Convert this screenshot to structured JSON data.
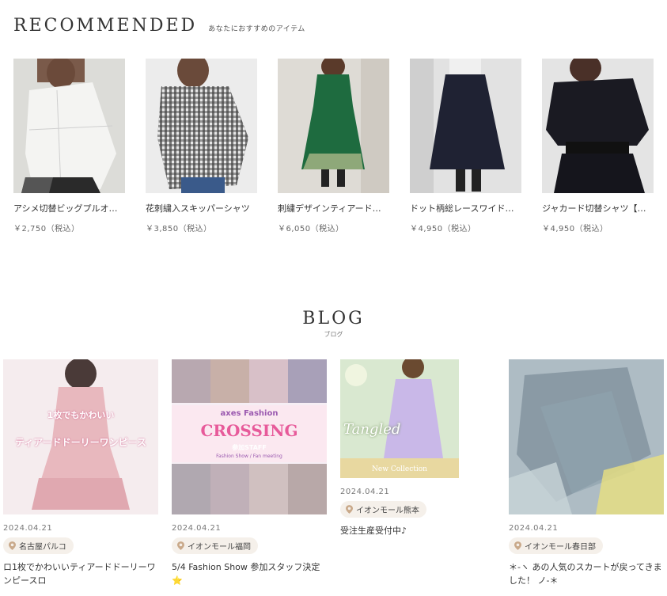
{
  "recommended": {
    "title": "RECOMMENDED",
    "subtitle": "あなたにおすすめのアイテム",
    "products": [
      {
        "name": "アシメ切替ビッグプルオ…",
        "price": "￥2,750（税込）"
      },
      {
        "name": "花刺繍入スキッパーシャツ",
        "price": "￥3,850（税込）"
      },
      {
        "name": "刺繍デザインティアード…",
        "price": "￥6,050（税込）"
      },
      {
        "name": "ドット柄総レースワイド…",
        "price": "￥4,950（税込）"
      },
      {
        "name": "ジャカード切替シャツ【…",
        "price": "￥4,950（税込）"
      }
    ]
  },
  "blog": {
    "title": "BLOG",
    "subtitle": "ブログ",
    "posts": [
      {
        "date": "2024.04.21",
        "store": "名古屋パルコ",
        "title": "ロ1枚でかわいいティアードドーリーワンピースロ",
        "img_text_1": "1枚でもかわいい",
        "img_text_2": "ティアードドーリーワンピース"
      },
      {
        "date": "2024.04.21",
        "store": "イオンモール福岡",
        "title": "5/4 Fashion Show 参加スタッフ決定⭐",
        "img_text_1": "axes Fashion",
        "img_text_2": "CROSSING",
        "img_text_3": "参加STAFF",
        "img_text_4": "Fashion Show / Fan meeting"
      },
      {
        "date": "2024.04.21",
        "store": "イオンモール熊本",
        "title": "受注生産受付中♪",
        "img_text_1": "Tangled",
        "img_text_2": "New Collection"
      },
      {
        "date": "2024.04.21",
        "store": "イオンモール春日部",
        "title": "＊-ヽ あの人気のスカートが戻ってきました！ ノ-＊"
      }
    ]
  },
  "icons": {
    "location": "map-pin-icon"
  },
  "colors": {
    "badge_bg": "#f5f0ea",
    "pin": "#c9a98a"
  }
}
